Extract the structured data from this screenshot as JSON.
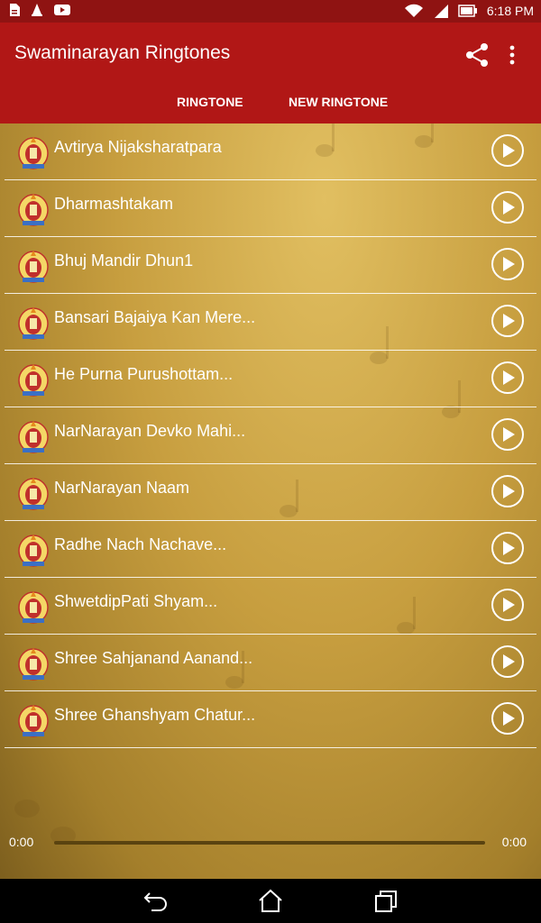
{
  "status_bar": {
    "time": "6:18 PM",
    "icons": [
      "file-icon",
      "vlc-icon",
      "youtube-icon",
      "wifi-icon",
      "signal-icon",
      "battery-icon"
    ]
  },
  "app_bar": {
    "title": "Swaminarayan Ringtones",
    "tabs": [
      {
        "label": "RINGTONE"
      },
      {
        "label": "NEW RINGTONE"
      }
    ],
    "actions": [
      "share-icon",
      "more-vert-icon"
    ]
  },
  "ringtones": [
    {
      "title": "Avtirya Nijaksharatpara"
    },
    {
      "title": "Dharmashtakam"
    },
    {
      "title": "Bhuj Mandir Dhun1"
    },
    {
      "title": "Bansari Bajaiya Kan Mere..."
    },
    {
      "title": "He Purna Purushottam..."
    },
    {
      "title": "NarNarayan Devko Mahi..."
    },
    {
      "title": "NarNarayan Naam"
    },
    {
      "title": "Radhe Nach Nachave..."
    },
    {
      "title": "ShwetdipPati Shyam..."
    },
    {
      "title": "Shree Sahjanand Aanand..."
    },
    {
      "title": "Shree Ghanshyam Chatur..."
    }
  ],
  "player": {
    "current_time": "0:00",
    "total_time": "0:00",
    "progress": 0
  },
  "nav_bar": [
    "back-icon",
    "home-icon",
    "recents-icon"
  ],
  "colors": {
    "status_bar": "#8f1312",
    "app_bar": "#b11716",
    "background_gold": "#c79e3f",
    "text": "#ffffff"
  }
}
